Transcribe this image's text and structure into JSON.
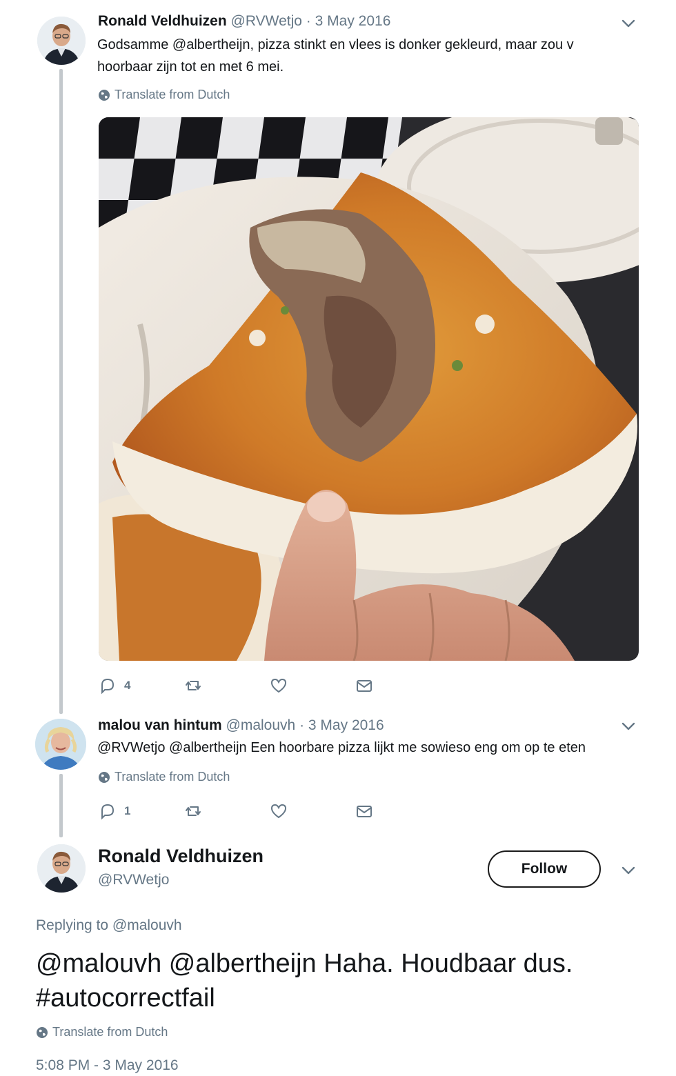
{
  "tweet1": {
    "name": "Ronald Veldhuizen",
    "handle": "@RVWetjo",
    "sep": "·",
    "date": "3 May 2016",
    "text_line1": "Godsamme @albertheijn, pizza stinkt en vlees is donker gekleurd, maar zou v",
    "text_line2": "hoorbaar zijn tot en met 6 mei.",
    "translate": "Translate from Dutch",
    "reply_count": "4",
    "media_alt": "pizza slice held over trash bin",
    "icons": [
      "reply-icon",
      "retweet-icon",
      "like-icon",
      "dm-icon",
      "chevron-down-icon",
      "globe-icon"
    ]
  },
  "tweet2": {
    "name": "malou van hintum",
    "handle": "@malouvh",
    "sep": "·",
    "date": "3 May 2016",
    "text": "@RVWetjo @albertheijn Een hoorbare pizza lijkt me sowieso eng om op te eten",
    "translate": "Translate from Dutch",
    "reply_count": "1"
  },
  "main_tweet": {
    "name": "Ronald Veldhuizen",
    "handle": "@RVWetjo",
    "follow_label": "Follow",
    "replying_prefix": "Replying to",
    "replying_handle": "@malouvh",
    "text_line1": "@malouvh @albertheijn Haha. Houdbaar dus.",
    "text_line2": "#autocorrectfail",
    "translate": "Translate from Dutch",
    "timestamp": "5:08 PM - 3 May 2016"
  },
  "colors": {
    "muted": "#657786",
    "text": "#14171a",
    "thread_line": "#c3c8cc"
  }
}
